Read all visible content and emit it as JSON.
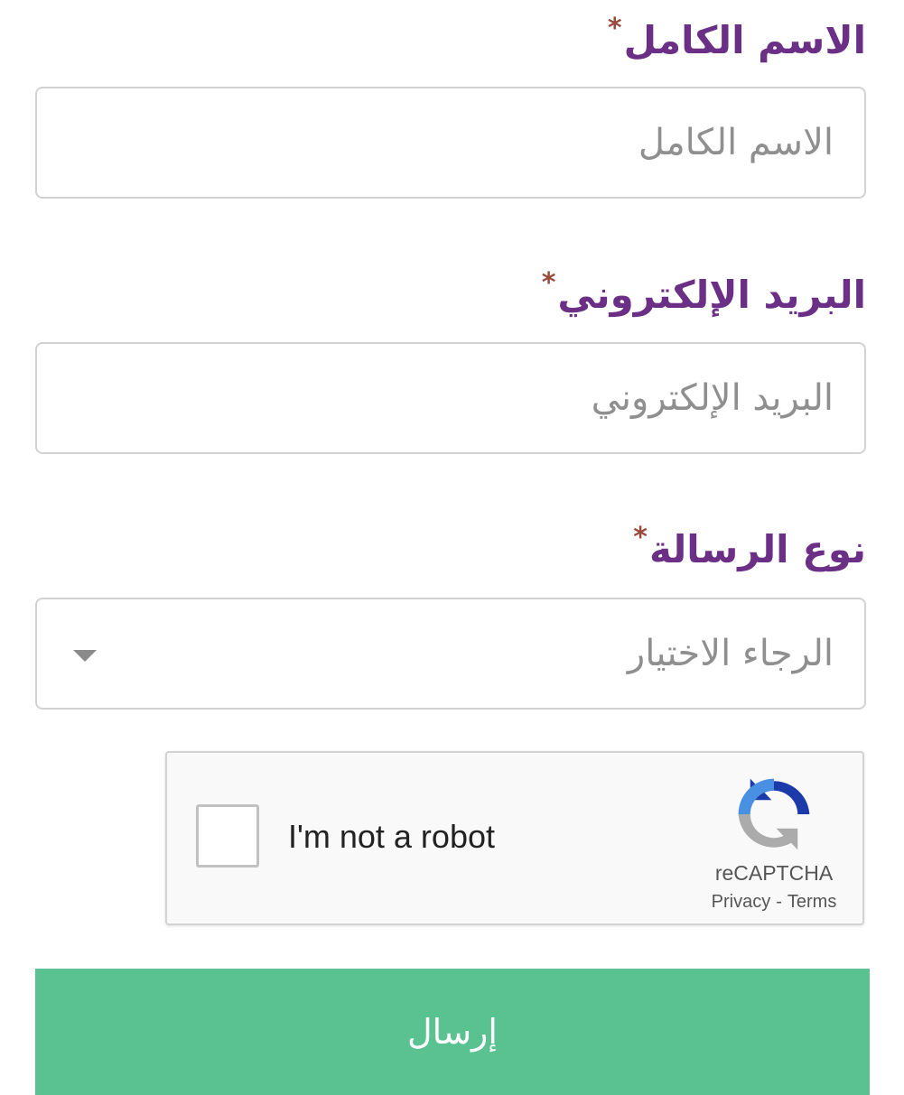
{
  "form": {
    "full_name": {
      "label": "الاسم الكامل",
      "required_mark": "*",
      "placeholder": "الاسم الكامل",
      "value": ""
    },
    "email": {
      "label": "البريد الإلكتروني",
      "required_mark": "*",
      "placeholder": "البريد الإلكتروني",
      "value": ""
    },
    "message_type": {
      "label": "نوع الرسالة",
      "required_mark": "*",
      "selected": "الرجاء الاختيار"
    },
    "recaptcha": {
      "checkbox_label": "I'm not a robot",
      "brand": "reCAPTCHA",
      "privacy": "Privacy",
      "separator": "-",
      "terms": "Terms",
      "checked": false,
      "icon": "recaptcha-logo-icon"
    },
    "submit_label": "إرسال"
  },
  "colors": {
    "label": "#6b2f86",
    "required": "#9a4a3c",
    "border": "#d2d2d2",
    "placeholder": "#8f8f8f",
    "submit_bg": "#5ac191"
  }
}
